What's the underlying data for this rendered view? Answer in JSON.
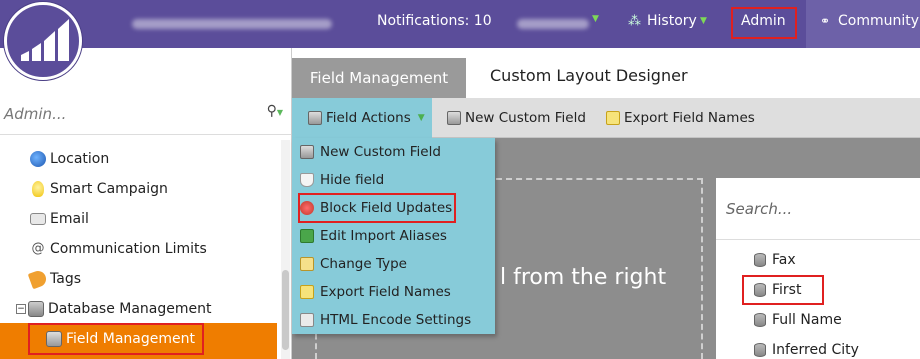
{
  "topbar": {
    "notifications": "Notifications: 10",
    "history": "History",
    "admin": "Admin",
    "community": "Community"
  },
  "left": {
    "search_placeholder": "Admin...",
    "items": [
      {
        "label": "Location",
        "icon": "globe-icon",
        "color": "#3a74c4"
      },
      {
        "label": "Smart Campaign",
        "icon": "lightbulb-icon",
        "color": "#f5c518"
      },
      {
        "label": "Email",
        "icon": "envelope-icon",
        "color": "#9aa3ad"
      },
      {
        "label": "Communication Limits",
        "icon": "at-sign-icon",
        "color": "#666666"
      },
      {
        "label": "Tags",
        "icon": "tag-icon",
        "color": "#f0a030"
      },
      {
        "label": "Database Management",
        "icon": "database-icon",
        "color": "#8a8a8a"
      },
      {
        "label": "Field Management",
        "icon": "database-icon",
        "color": "#8a8a8a"
      }
    ]
  },
  "tabs": {
    "active": "Field Management",
    "other": "Custom Layout Designer"
  },
  "toolbar": {
    "field_actions": "Field Actions",
    "new_custom_field": "New Custom Field",
    "export_field_names": "Export Field Names"
  },
  "menu": {
    "items": [
      {
        "label": "New Custom Field",
        "icon": "database-add-icon"
      },
      {
        "label": "Hide field",
        "icon": "flask-icon"
      },
      {
        "label": "Block Field Updates",
        "icon": "block-icon"
      },
      {
        "label": "Edit Import Aliases",
        "icon": "alias-icon"
      },
      {
        "label": "Change Type",
        "icon": "edit-icon"
      },
      {
        "label": "Export Field Names",
        "icon": "document-icon"
      },
      {
        "label": "HTML Encode Settings",
        "icon": "html-icon"
      }
    ]
  },
  "main": {
    "drop_text": "l from the right"
  },
  "fieldlist": {
    "search_placeholder": "Search...",
    "items": [
      "Fax",
      "First",
      "Full Name",
      "Inferred City"
    ]
  },
  "colors": {
    "topbar": "#5b4d9a",
    "selected": "#ef7d00",
    "menu": "#87cbd9",
    "highlight": "#e02020"
  }
}
